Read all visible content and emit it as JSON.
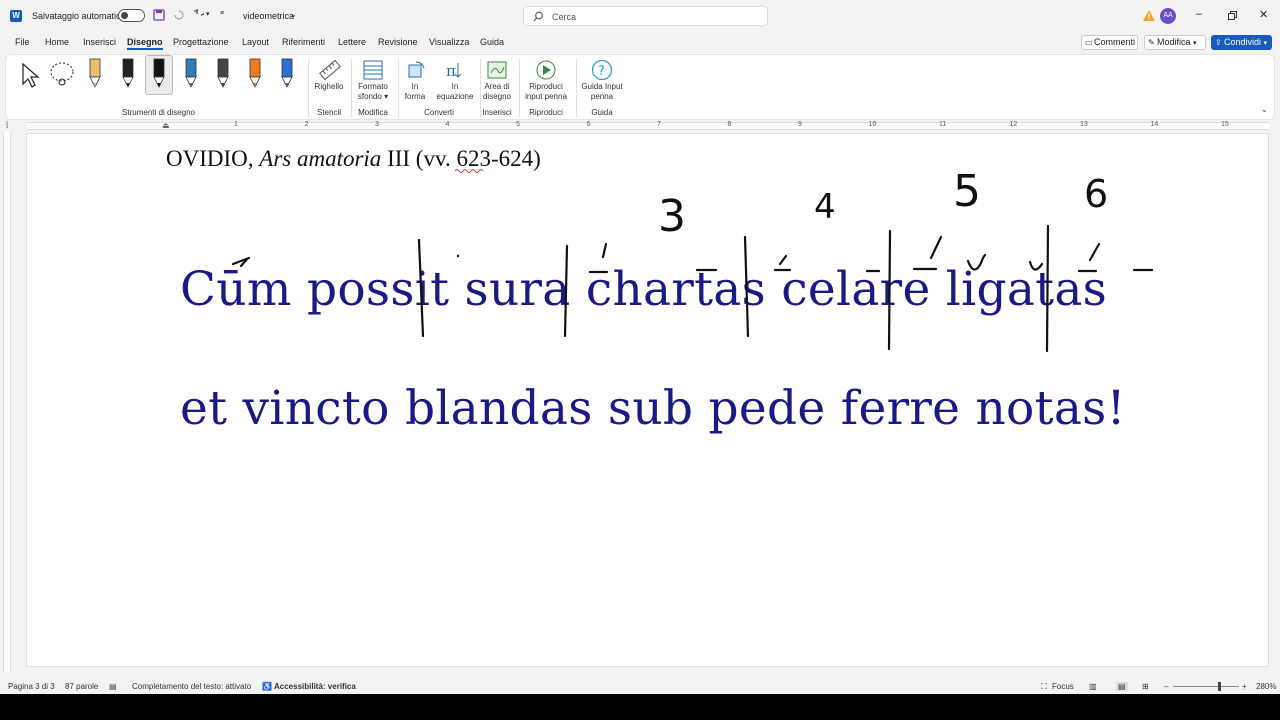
{
  "titlebar": {
    "autosave_label": "Salvataggio automatico",
    "doc_name": "videometrica",
    "search_placeholder": "Cerca",
    "avatar_initials": "AA"
  },
  "menu": {
    "items": [
      "File",
      "Home",
      "Inserisci",
      "Disegno",
      "Progettazione",
      "Layout",
      "Riferimenti",
      "Lettere",
      "Revisione",
      "Visualizza",
      "Guida"
    ],
    "active": "Disegno",
    "comments_label": "Commenti",
    "edit_label": "Modifica",
    "share_label": "Condividi"
  },
  "ribbon": {
    "groups": {
      "drawing_tools": "Strumenti di disegno",
      "stencils": "Stencil",
      "edit": "Modifica",
      "convert": "Converti",
      "insert": "Inserisci",
      "replay": "Riproduci",
      "help": "Guida"
    },
    "buttons": {
      "ruler": "Righello",
      "bg_format_1": "Formato",
      "bg_format_2": "sfondo",
      "to_shape_1": "In",
      "to_shape_2": "forma",
      "to_math_1": "In",
      "to_math_2": "equazione",
      "canvas_1": "Area di",
      "canvas_2": "disegno",
      "replay_1": "Riproduci",
      "replay_2": "input penna",
      "help_1": "Guida Input",
      "help_2": "penna"
    },
    "pen_colors": [
      "#e8c070",
      "#222222",
      "#111111",
      "#2f7fb5",
      "#444444",
      "#f07a20",
      "#2c6fd6"
    ]
  },
  "ruler": {
    "numbers": [
      "1",
      "2",
      "3",
      "4",
      "5",
      "6",
      "7",
      "8",
      "9",
      "10",
      "11",
      "12",
      "13",
      "14",
      "15"
    ]
  },
  "document": {
    "heading_author": "OVIDIO,",
    "heading_work": "Ars amatoria",
    "heading_ref": "III (vv. 623-624)",
    "verse1": "Cūm possit sura chartas celare ligatas",
    "verse2": "et vincto blandas sub pede ferre notas!",
    "annotations": [
      "3",
      "4",
      "5",
      "6"
    ],
    "verse_color": "#1a1a86"
  },
  "statusbar": {
    "page": "Pagina 3 di 3",
    "words": "87 parole",
    "completion": "Completamento del testo: attivato",
    "accessibility": "Accessibilità: verifica",
    "focus": "Focus",
    "zoom": "280%"
  }
}
